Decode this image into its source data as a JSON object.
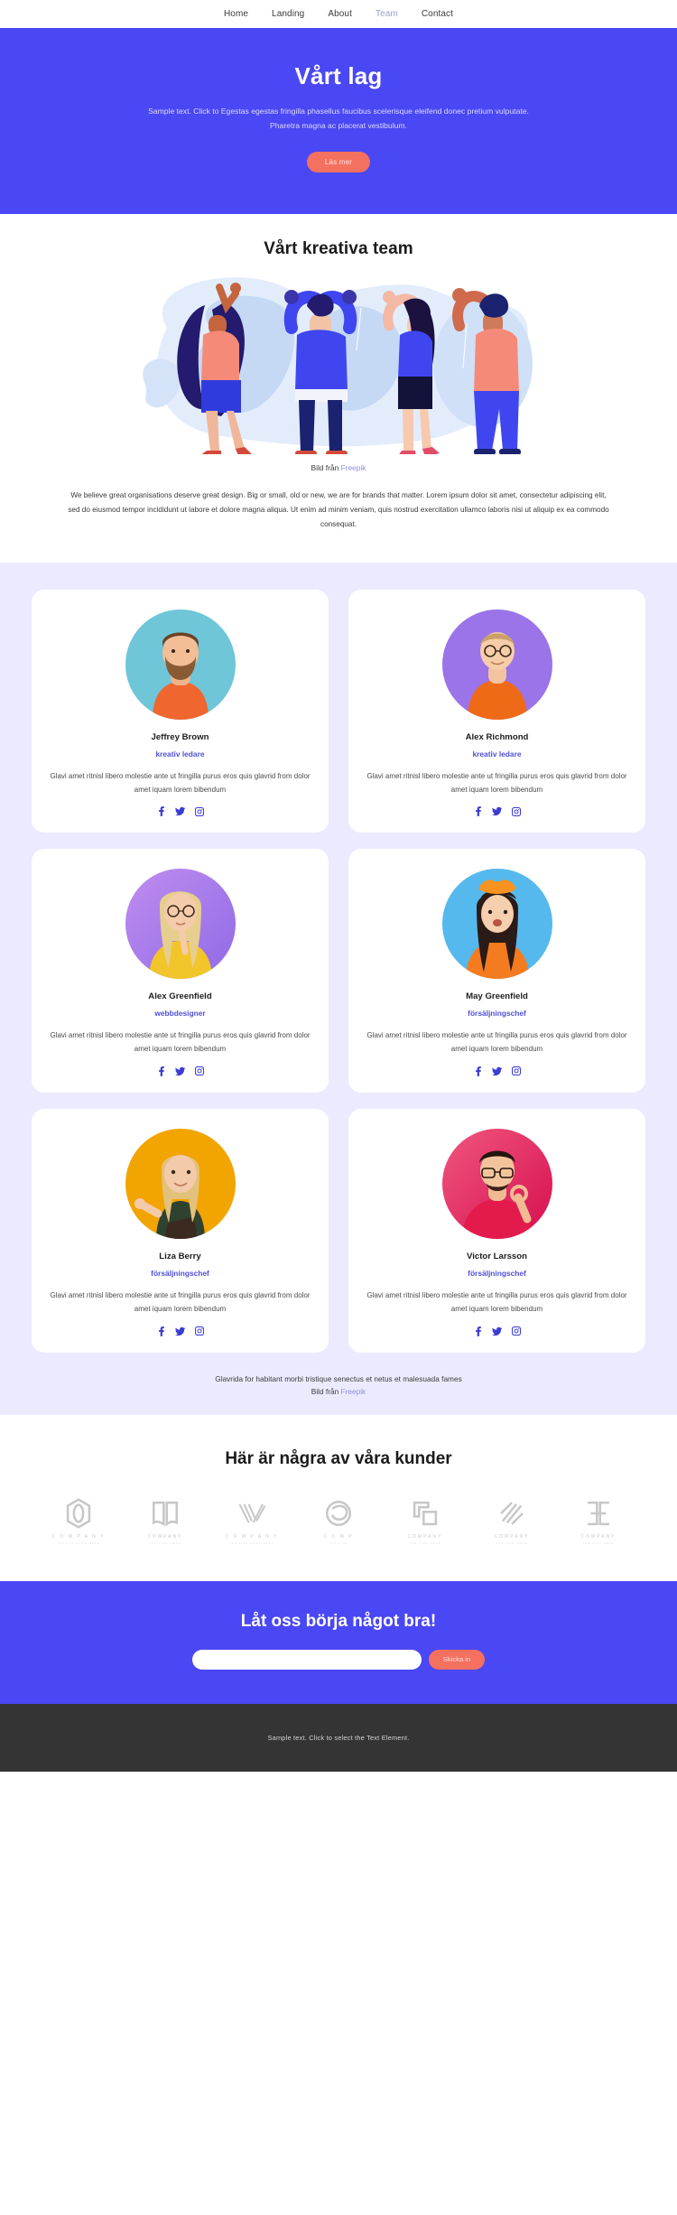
{
  "nav": {
    "items": [
      {
        "label": "Home",
        "active": false
      },
      {
        "label": "Landing",
        "active": false
      },
      {
        "label": "About",
        "active": false
      },
      {
        "label": "Team",
        "active": true
      },
      {
        "label": "Contact",
        "active": false
      }
    ]
  },
  "hero": {
    "title": "Vårt lag",
    "subtitle": "Sample text. Click to Egestas egestas fringilla phasellus faucibus scelerisque eleifend donec pretium vulputate. Pharetra magna ac placerat vestibulum.",
    "button": "Läs mer",
    "bg_color": "#4a47f5",
    "button_color": "#f4705f"
  },
  "creative": {
    "heading": "Vårt kreativa team",
    "credit_prefix": "Bild från ",
    "credit_link": "Freepik",
    "paragraph": "We believe great organisations deserve great design. Big or small, old or new, we are for brands that matter. Lorem ipsum dolor sit amet, consectetur adipiscing elit, sed do eiusmod tempor incididunt ut labore et dolore magna aliqua. Ut enim ad minim veniam, quis nostrud exercitation ullamco laboris nisi ut aliquip ex ea commodo consequat."
  },
  "team": {
    "bg_color": "#eceaff",
    "members": [
      {
        "name": "Jeffrey Brown",
        "role": "kreativ ledare",
        "desc": "Glavi amet ritnisl libero molestie ante ut fringilla purus eros quis glavrid from dolor amet iquam lorem bibendum",
        "avatar_bg": "#6ec6d8",
        "shirt": "#f0662f",
        "skin": "#f0b48a",
        "hair": "#6b4226"
      },
      {
        "name": "Alex Richmond",
        "role": "kreativ ledare",
        "desc": "Glavi amet ritnisl libero molestie ante ut fringilla purus eros quis glavrid from dolor amet iquam lorem bibendum",
        "avatar_bg": "#9a74e8",
        "shirt": "#ef6a17",
        "skin": "#f3c3a0",
        "hair": "#caa06a"
      },
      {
        "name": "Alex Greenfield",
        "role": "webbdesigner",
        "desc": "Glavi amet ritnisl libero molestie ante ut fringilla purus eros quis glavrid from dolor amet iquam lorem bibendum",
        "avatar_bg": "#b07ae8",
        "shirt": "#f2c52b",
        "skin": "#f4cbab",
        "hair": "#e6cf8e"
      },
      {
        "name": "May Greenfield",
        "role": "försäljningschef",
        "desc": "Glavi amet ritnisl libero molestie ante ut fringilla purus eros quis glavrid from dolor amet iquam lorem bibendum",
        "avatar_bg": "#55b9ee",
        "shirt": "#f57b20",
        "skin": "#f6cfae",
        "hair": "#2b1b16"
      },
      {
        "name": "Liza Berry",
        "role": "försäljningschef",
        "desc": "Glavi amet ritnisl libero molestie ante ut fringilla purus eros quis glavrid from dolor amet iquam lorem bibendum",
        "avatar_bg": "#f2a400",
        "shirt": "#2f4230",
        "skin": "#f3cbab",
        "hair": "#e3c17a"
      },
      {
        "name": "Victor Larsson",
        "role": "försäljningschef",
        "desc": "Glavi amet ritnisl libero molestie ante ut fringilla purus eros quis glavrid from dolor amet iquam lorem bibendum",
        "avatar_bg": "#e8275f",
        "shirt": "#e31b4d",
        "skin": "#f0bb93",
        "hair": "#24150f"
      }
    ],
    "socials": [
      "facebook-icon",
      "twitter-icon",
      "instagram-icon"
    ],
    "footnote": "Glavrida for habitant morbi tristique senectus et netus et malesuada fames",
    "footnote_credit_prefix": "Bild från ",
    "footnote_credit_link": "Freepik"
  },
  "clients": {
    "heading": "Här är några av våra kunder",
    "logos": [
      {
        "name": "C O M P A N Y",
        "tagline": "TAGLINE GOES HERE",
        "mark": "circle-hex-mark"
      },
      {
        "name": "COMPANY",
        "tagline": "TAG LINE HERE",
        "mark": "open-book-mark"
      },
      {
        "name": "C O M P A N Y",
        "tagline": "TAG LINE GOES HERE",
        "mark": "chevron-stripes-mark"
      },
      {
        "name": "C O M P",
        "tagline": "TAG L NE",
        "mark": "swirl-circle-mark"
      },
      {
        "name": "COMPANY",
        "tagline": "TAG LINE HERE",
        "mark": "corner-squares-mark"
      },
      {
        "name": "COMPANY",
        "tagline": "TAG LINE HERE",
        "mark": "diagonal-lines-mark"
      },
      {
        "name": "COMPANY",
        "tagline": "TAG LINE HERE",
        "mark": "bracket-mark"
      }
    ]
  },
  "cta": {
    "heading": "Låt oss börja något bra!",
    "input_value": "",
    "input_placeholder": "",
    "button": "Skicka in"
  },
  "footer": {
    "text": "Sample text. Click to select the Text Element.",
    "bg_color": "#343434"
  }
}
